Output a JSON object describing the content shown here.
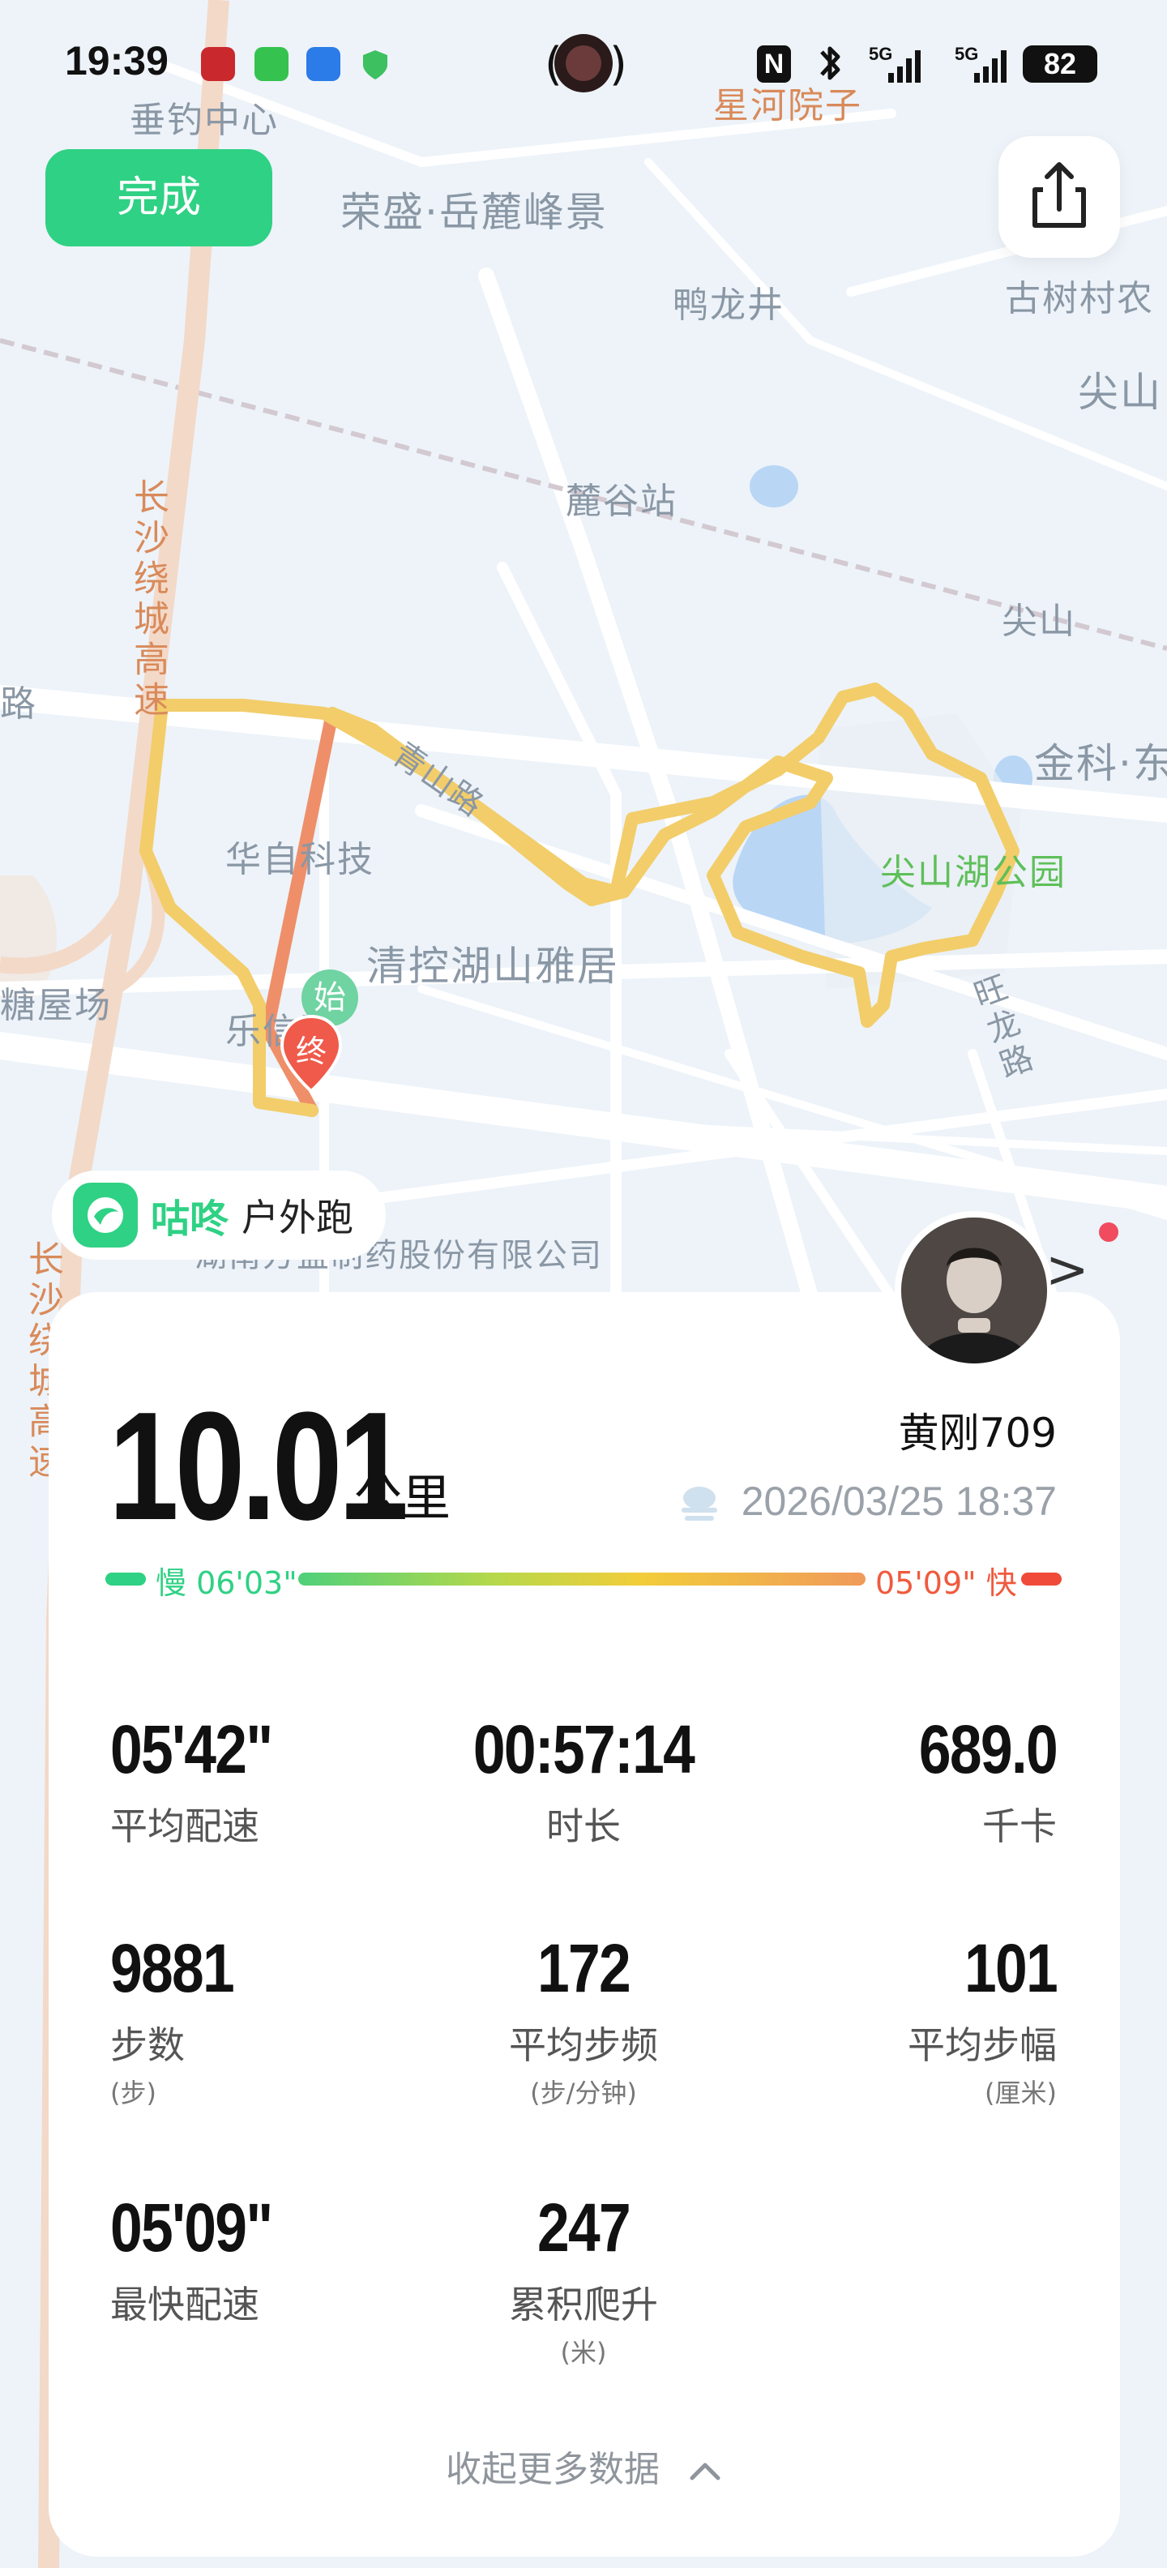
{
  "status_bar": {
    "time": "19:39",
    "network_1": "5G",
    "network_2": "5G",
    "battery": "82"
  },
  "buttons": {
    "done_label": "完成",
    "share_icon": "share-icon"
  },
  "map_labels": [
    {
      "text": "垂钓中心",
      "style": "normal"
    },
    {
      "text": "荣盛·岳麓峰景",
      "style": "normal"
    },
    {
      "text": "星河院子",
      "style": "orange"
    },
    {
      "text": "鸭龙井",
      "style": "normal"
    },
    {
      "text": "古树村农",
      "style": "normal"
    },
    {
      "text": "尖山",
      "style": "normal"
    },
    {
      "text": "麓谷站",
      "style": "normal"
    },
    {
      "text": "尖山",
      "style": "normal"
    },
    {
      "text": "金科·东",
      "style": "normal"
    },
    {
      "text": "长沙绕城高速",
      "style": "vertical-orange"
    },
    {
      "text": "路",
      "style": "normal"
    },
    {
      "text": "青山路",
      "style": "normal"
    },
    {
      "text": "华自科技",
      "style": "normal"
    },
    {
      "text": "尖山湖公园",
      "style": "green"
    },
    {
      "text": "清控湖山雅居",
      "style": "normal"
    },
    {
      "text": "糖屋场",
      "style": "normal"
    },
    {
      "text": "乐信团",
      "style": "normal"
    },
    {
      "text": "旺龙路",
      "style": "vertical"
    },
    {
      "text": "湖南方盛制药股份有限公司",
      "style": "normal"
    },
    {
      "text": "长沙绕城高速",
      "style": "vertical-orange"
    }
  ],
  "route_markers": {
    "start": "始",
    "end": "终"
  },
  "app": {
    "brand": "咕咚",
    "sport": "户外跑"
  },
  "summary": {
    "distance": "10.01",
    "distance_unit": "公里",
    "username": "黄刚709",
    "datetime": "2026/03/25 18:37"
  },
  "pace_legend": {
    "slow": "慢 06'03\"",
    "fast": "05'09\" 快"
  },
  "stats": [
    {
      "value": "05'42\"",
      "label": "平均配速",
      "sub": ""
    },
    {
      "value": "00:57:14",
      "label": "时长",
      "sub": ""
    },
    {
      "value": "689.0",
      "label": "千卡",
      "sub": ""
    },
    {
      "value": "9881",
      "label": "步数",
      "sub": "(步)"
    },
    {
      "value": "172",
      "label": "平均步频",
      "sub": "(步/分钟)"
    },
    {
      "value": "101",
      "label": "平均步幅",
      "sub": "(厘米)"
    },
    {
      "value": "05'09\"",
      "label": "最快配速",
      "sub": ""
    },
    {
      "value": "247",
      "label": "累积爬升",
      "sub": "(米)"
    }
  ],
  "footer": {
    "collapse_label": "收起更多数据"
  },
  "colors": {
    "accent_green": "#2fd184",
    "route_yellow": "#f2cd6a",
    "route_orange": "#ee8f6a",
    "marker_red": "#ef5a4a"
  }
}
